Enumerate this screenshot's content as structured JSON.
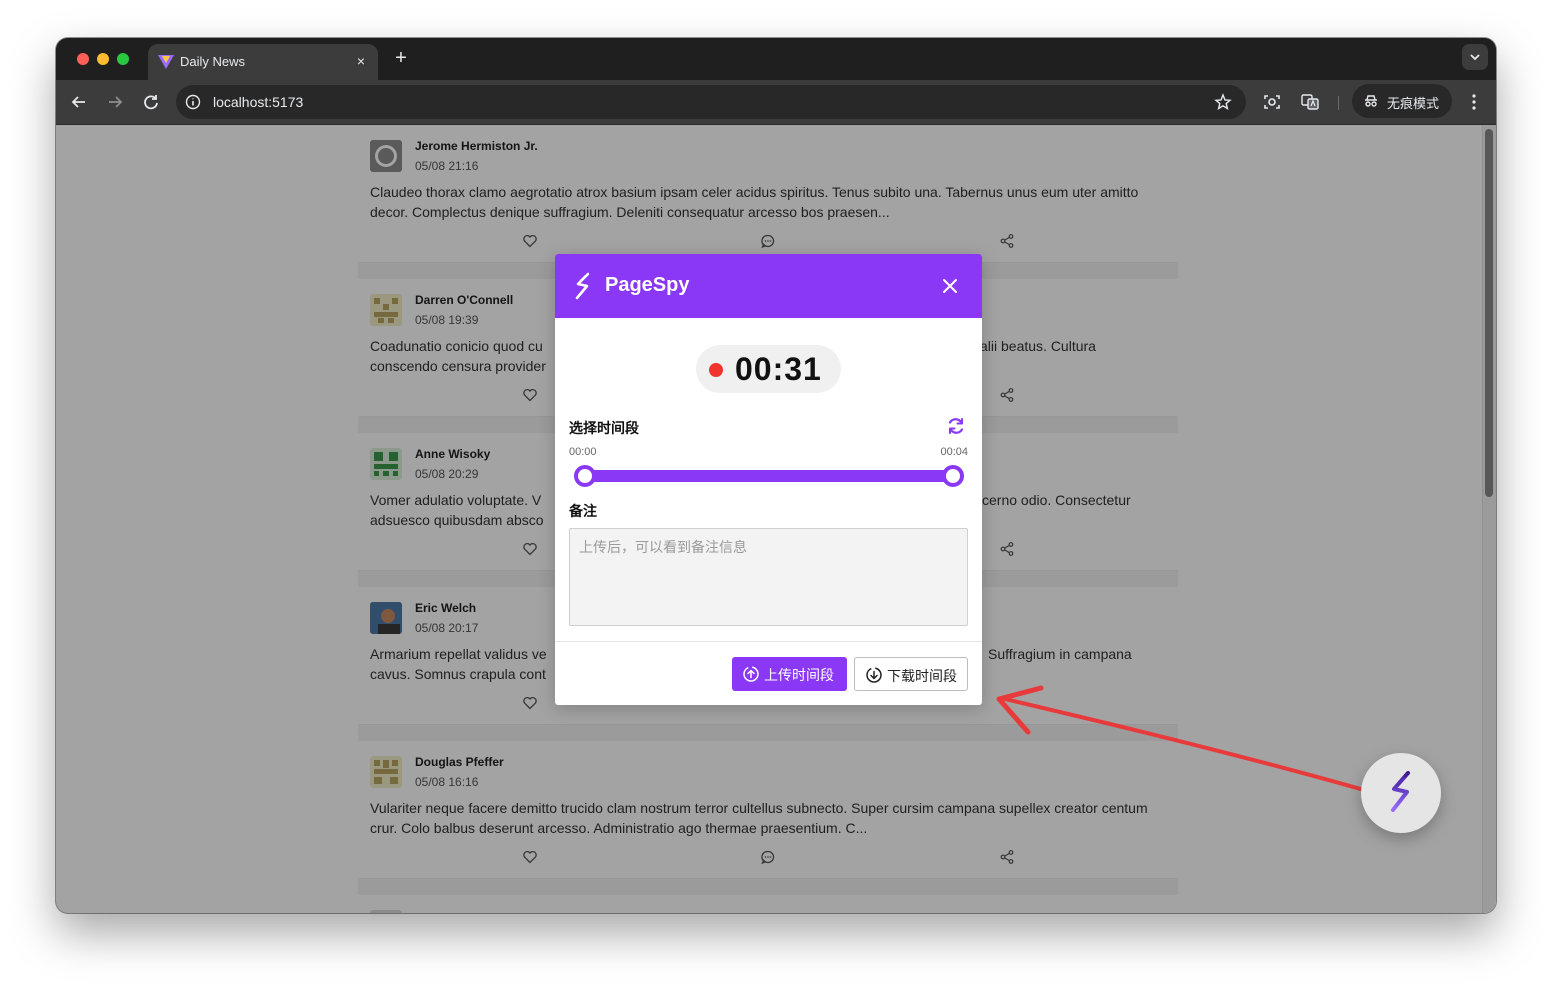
{
  "browser": {
    "tab_title": "Daily News",
    "tab_close": "×",
    "new_tab": "+",
    "url": "localhost:5173",
    "incognito_label": "无痕模式"
  },
  "posts": [
    {
      "author": "Jerome Hermiston Jr.",
      "time": "05/08 21:16",
      "text": "Claudeo thorax clamo aegrotatio atrox basium ipsam celer acidus spiritus. Tenus subito una. Tabernus unus eum uter amitto decor. Complectus denique suffragium. Deleniti consequatur arcesso bos praesen..."
    },
    {
      "author": "Darren O'Connell",
      "time": "05/08 19:39",
      "text": "Coadunatio conicio quod cu[obscured] alii beatus. Cultura conscendo censura provider[obscured]"
    },
    {
      "author": "Anne Wisoky",
      "time": "05/08 20:29",
      "text": "Vomer adulatio voluptate. V[obscured] cerno odio. Consectetur adsuesco quibusdam absco[obscured]"
    },
    {
      "author": "Eric Welch",
      "time": "05/08 20:17",
      "text": "Armarium repellat validus ve[obscured] Suffragium in campana cavus. Somnus crapula cont[obscured]"
    },
    {
      "author": "Douglas Pfeffer",
      "time": "05/08 16:16",
      "text": "Vulariter neque facere demitto trucido clam nostrum terror cultellus subnecto. Super cursim campana supellex creator centum crur. Colo balbus deserunt arcesso. Administratio ago thermae praesentium. C..."
    }
  ],
  "post_texts_visible": [
    "Claudeo thorax clamo aegrotatio atrox basium ipsam celer acidus spiritus. Tenus subito una. Tabernus unus eum uter amitto decor. Complectus denique suffragium. Deleniti consequatur arcesso bos praesen...",
    "Coadunatio conicio quod cu",
    "conscendo censura provider",
    "alii beatus. Cultura",
    "Vomer adulatio voluptate. V",
    "adsuesco quibusdam absco",
    "cerno odio. Consectetur",
    "Armarium repellat validus ve",
    "cavus. Somnus crapula cont",
    "Suffragium in campana",
    "Vulariter neque facere demitto trucido clam nostrum terror cultellus subnecto. Super cursim campana supellex creator centum crur. Colo balbus deserunt arcesso. Administratio ago thermae praesentium. C..."
  ],
  "modal": {
    "title": "PageSpy",
    "timer": "00:31",
    "select_label": "选择时间段",
    "range_start": "00:00",
    "range_end": "00:04",
    "slider_start_fraction": 0,
    "slider_end_fraction": 1,
    "remark_label": "备注",
    "remark_placeholder": "上传后，可以看到备注信息",
    "remark_value": "",
    "upload_label": "上传时间段",
    "download_label": "下载时间段"
  },
  "colors": {
    "accent": "#8a38f5",
    "recording": "#f2342f",
    "annotation_arrow": "#e83a3a"
  },
  "icons": {
    "logo": "pagespy-logo-icon",
    "close": "close-icon",
    "refresh": "refresh-icon",
    "upload": "upload-icon",
    "download": "download-icon",
    "like": "heart-icon",
    "comment": "comment-icon",
    "share": "share-icon"
  }
}
